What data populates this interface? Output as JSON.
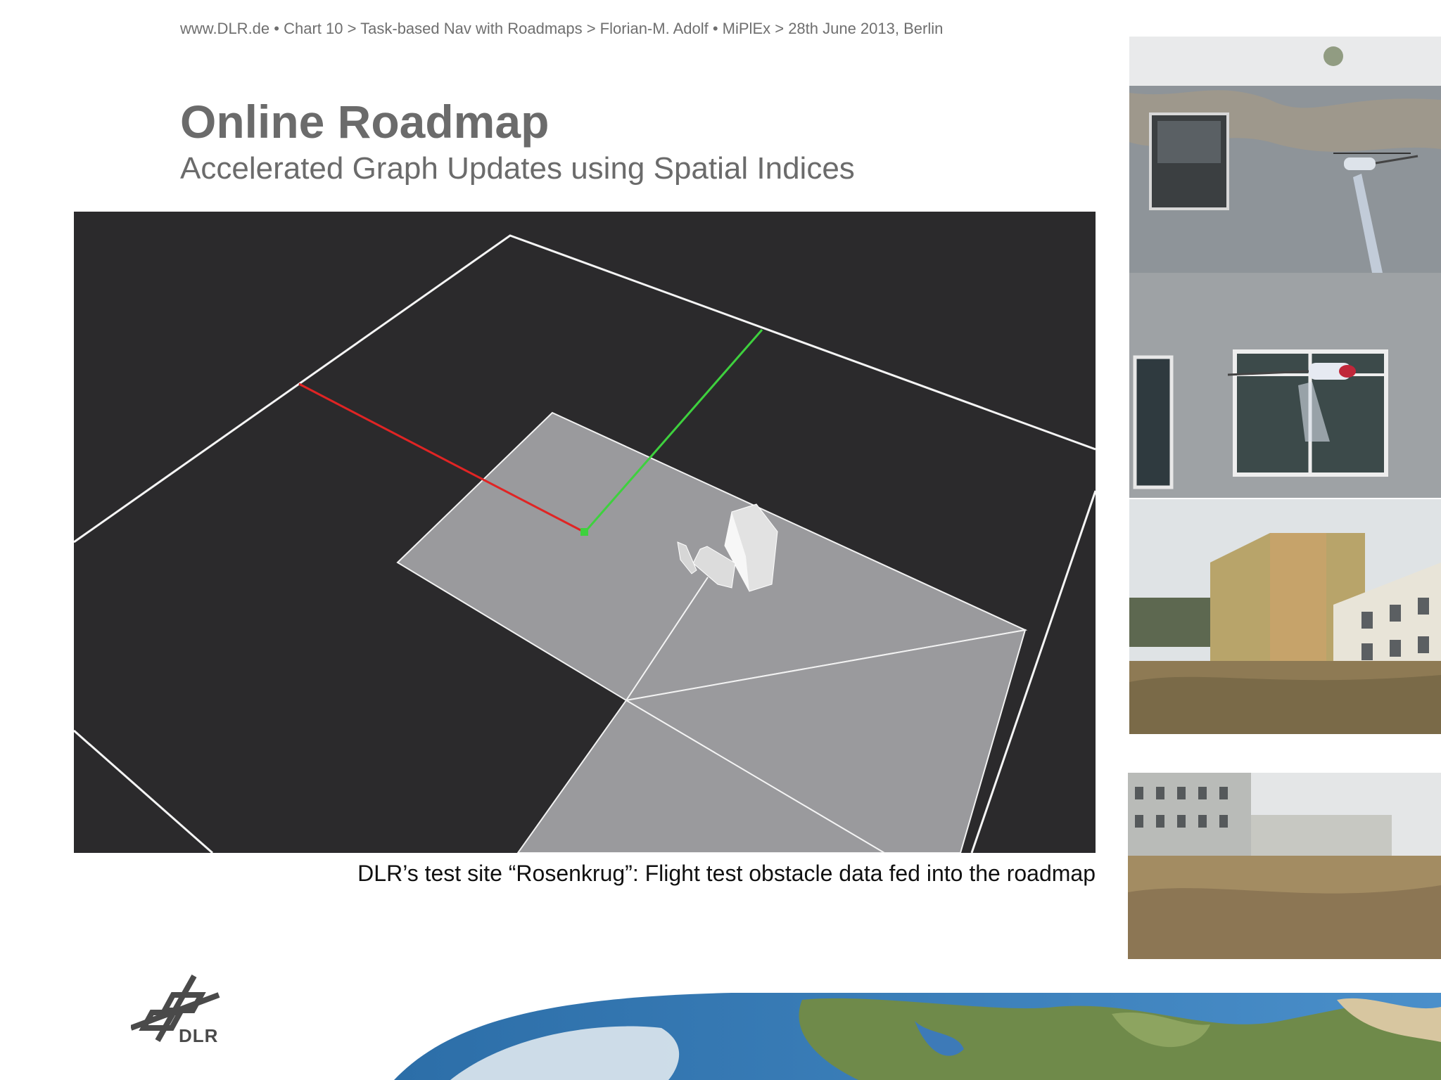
{
  "header": {
    "breadcrumb": "www.DLR.de  •  Chart 10  > Task-based Nav with Roadmaps > Florian-M. Adolf • MiPlEx > 28th June 2013, Berlin"
  },
  "slide": {
    "title": "Online Roadmap",
    "subtitle": "Accelerated Graph Updates using Spatial Indices"
  },
  "figure": {
    "caption": "DLR’s test site “Rosenkrug”: Flight test obstacle data fed into the roadmap"
  },
  "logo": {
    "text": "DLR"
  },
  "colors": {
    "text_gray": "#6b6b6b",
    "viz_background": "#2b2a2c",
    "plane_gray": "#9a9a9d",
    "axis_red": "#e02424",
    "axis_green": "#3ed13e"
  }
}
